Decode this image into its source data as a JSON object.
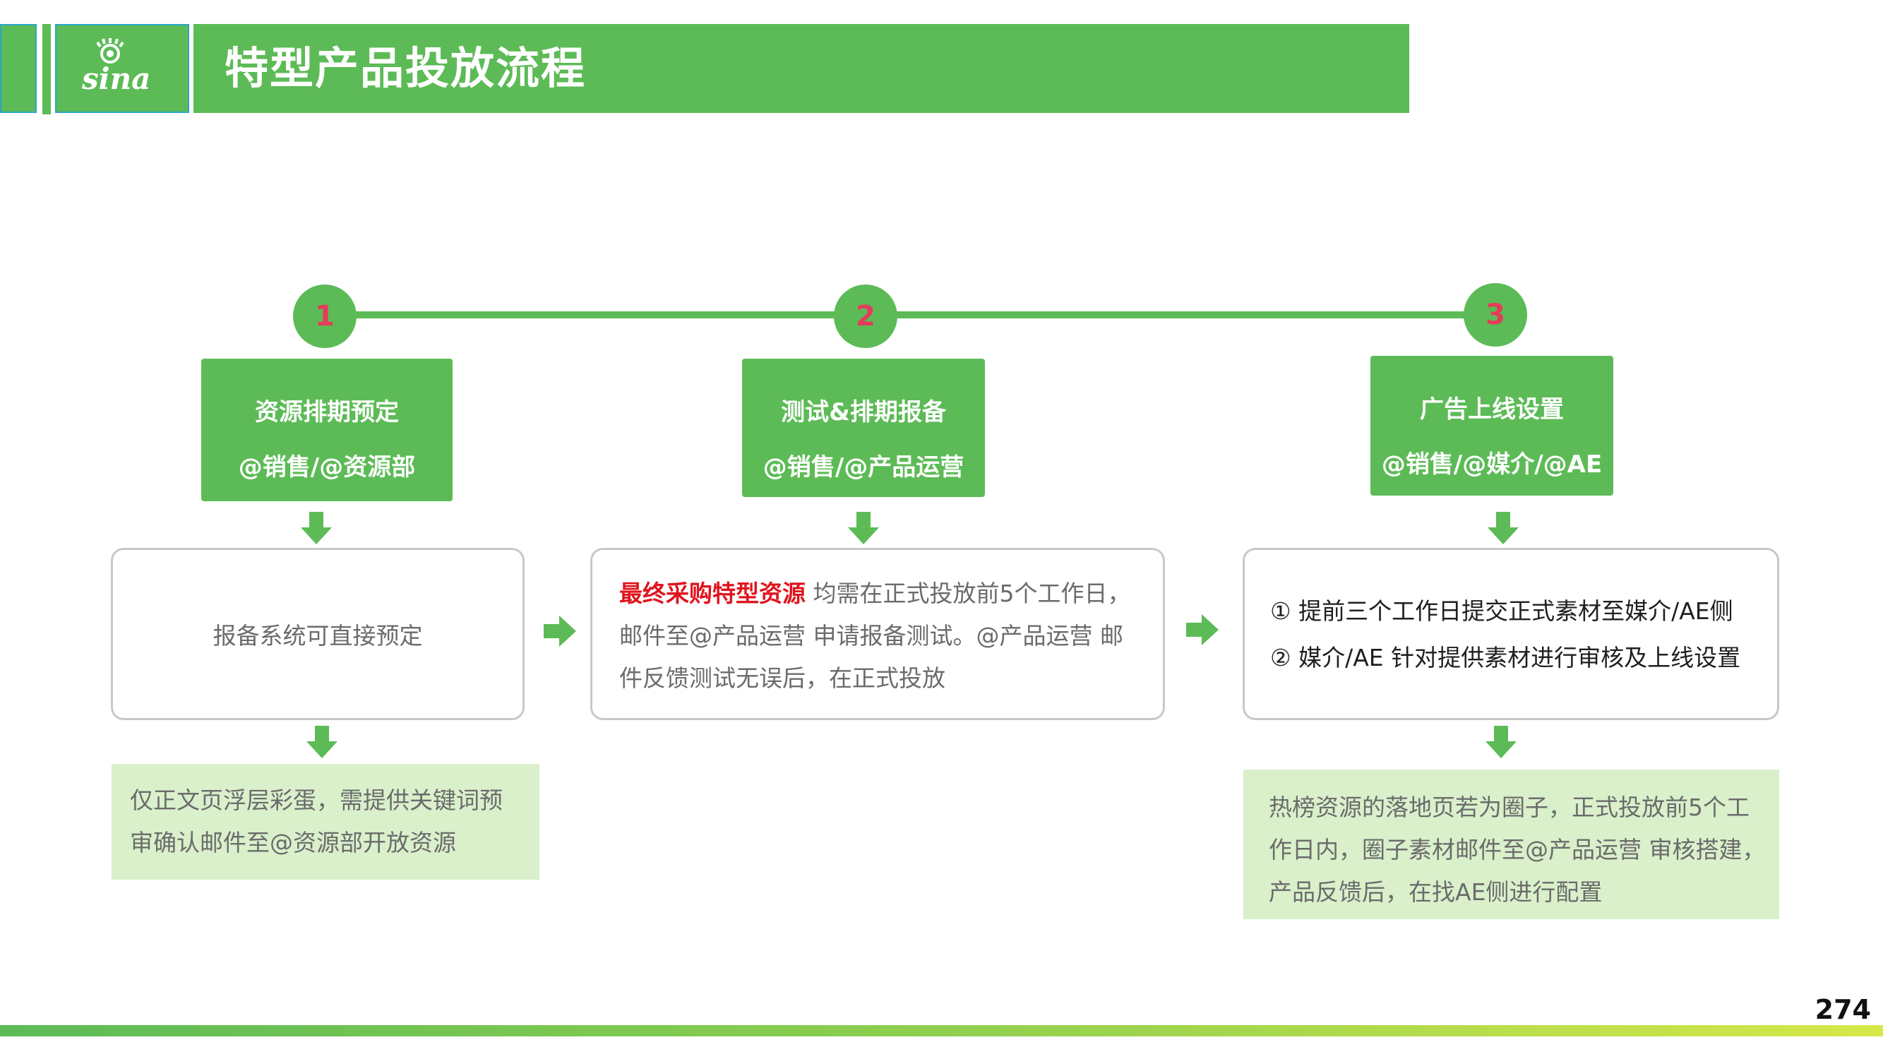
{
  "header": {
    "logo_text": "sina",
    "title": "特型产品投放流程"
  },
  "steps": [
    {
      "number": "1",
      "title": "资源排期预定",
      "owners": "@销售/@资源部"
    },
    {
      "number": "2",
      "title": "测试&排期报备",
      "owners": "@销售/@产品运营"
    },
    {
      "number": "3",
      "title": "广告上线设置",
      "owners": "@销售/@媒介/@AE"
    }
  ],
  "boxes": {
    "box1": {
      "text": "报备系统可直接预定"
    },
    "box2": {
      "highlight": "最终采购特型资源",
      "line1": " 均需在正式投放前5个工作日，",
      "line2": "邮件至@产品运营 申请报备测试。@产品运营 邮",
      "line3": "件反馈测试无误后，在正式投放"
    },
    "box3": {
      "line1": "① 提前三个工作日提交正式素材至媒介/AE侧",
      "line2": "② 媒介/AE 针对提供素材进行审核及上线设置"
    }
  },
  "notes": {
    "note1": {
      "line1": "仅正文页浮层彩蛋，需提供关键词预",
      "line2": "审确认邮件至@资源部开放资源"
    },
    "note3": {
      "line1": "热榜资源的落地页若为圈子，正式投放前5个工",
      "line2": "作日内，圈子素材邮件至@产品运营 审核搭建，",
      "line3": "产品反馈后，在找AE侧进行配置"
    }
  },
  "page_number": "274",
  "colors": {
    "primary_green": "#5cbb56",
    "light_green": "#d9f0cb",
    "highlight_red": "#e0141e",
    "number_red": "#e63b5a",
    "accent_blue": "#2aa6c8"
  }
}
